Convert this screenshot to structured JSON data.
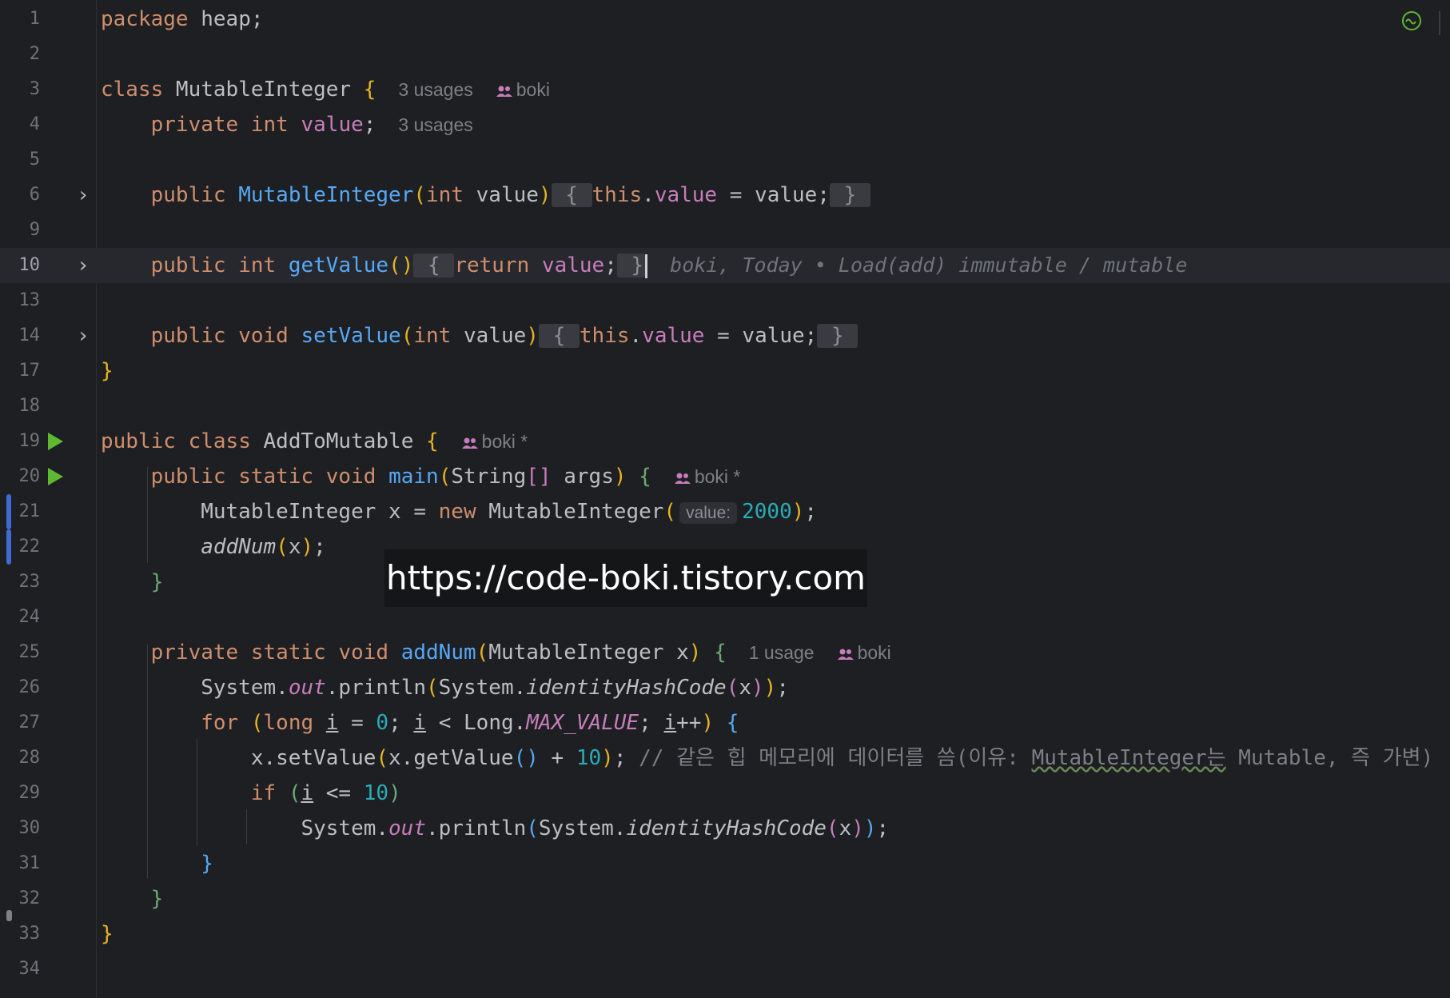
{
  "editor": {
    "package_kw": "package",
    "package_name": "heap;",
    "hints": {
      "usages3": "3 usages",
      "usage1": "1 usage",
      "author": "boki",
      "author_mod": "boki *",
      "param_value": "value:",
      "blame": "boki, Today • Load(add) immutable / mutable"
    },
    "line_numbers": [
      "1",
      "2",
      "3",
      "4",
      "5",
      "6",
      "9",
      "10",
      "13",
      "14",
      "17",
      "18",
      "19",
      "20",
      "21",
      "22",
      "23",
      "24",
      "25",
      "26",
      "27",
      "28",
      "29",
      "30",
      "31",
      "32",
      "33",
      "34"
    ],
    "comment_line28": "// 같은 힙 메모리에 데이터를 씀(이유: ",
    "comment_line28_underlined": "MutableInteger는",
    "comment_line28_tail": " Mutable, 즉 가변)",
    "watermark": "https://code-boki.tistory.com"
  },
  "colors": {
    "background": "#1e1f22",
    "current_line": "#26282e",
    "keyword": "#cf8e6d",
    "field": "#c77dbb",
    "function": "#56a8f5",
    "number": "#2aacb8",
    "run_icon": "#5fb832",
    "vcs_marker": "#3e6cd0"
  },
  "icons": {
    "fold": "chevron-right-icon",
    "run": "run-triangle-icon",
    "people": "people-icon",
    "inspection": "inspection-ok-icon"
  }
}
